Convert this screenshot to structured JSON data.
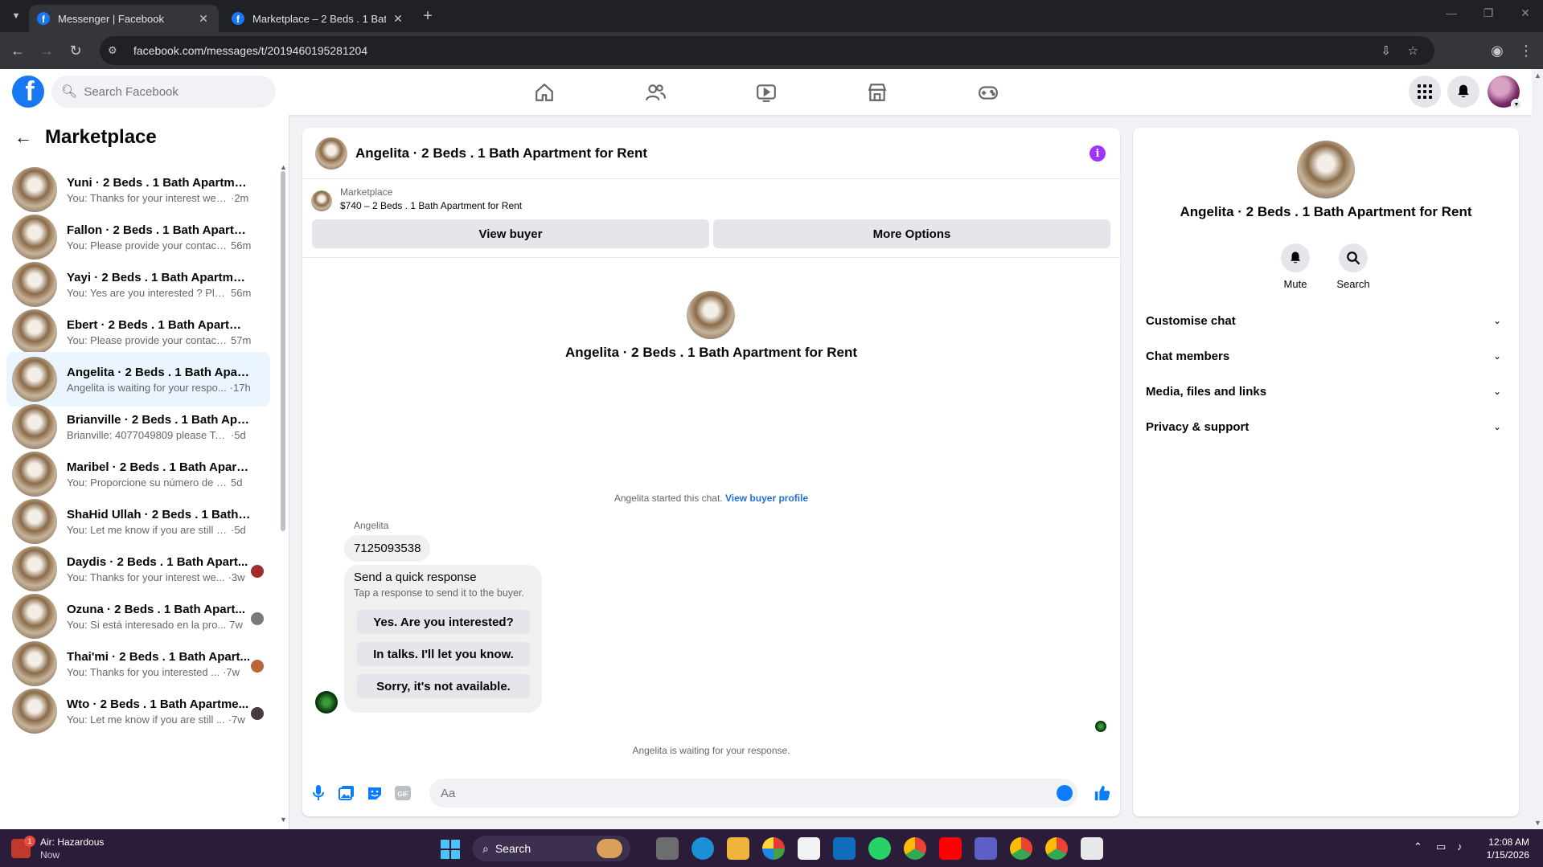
{
  "browser": {
    "tabs": [
      {
        "title": "Messenger | Facebook",
        "active": true
      },
      {
        "title": "Marketplace – 2 Beds . 1 Bath A",
        "active": false
      }
    ],
    "url": "facebook.com/messages/t/2019460195281204"
  },
  "header": {
    "search_placeholder": "Search Facebook",
    "nav_icons": [
      "home-icon",
      "friends-icon",
      "video-icon",
      "marketplace-icon",
      "gaming-icon"
    ]
  },
  "sidebar": {
    "title": "Marketplace",
    "conversations": [
      {
        "name": "Yuni · 2 Beds . 1 Bath Apartment...",
        "preview": "You: Thanks for your interest we'll ...",
        "time": "·2m",
        "active": false
      },
      {
        "name": "Fallon · 2 Beds . 1 Bath Apartme...",
        "preview": "You: Please provide your contact ...",
        "time": "56m",
        "active": false
      },
      {
        "name": "Yayi · 2 Beds . 1 Bath Apartment ...",
        "preview": "You: Yes are you interested ? Plea...",
        "time": "56m",
        "active": false
      },
      {
        "name": "Ebert · 2 Beds . 1 Bath Apartmen...",
        "preview": "You: Please provide your contact ...",
        "time": "57m",
        "active": false
      },
      {
        "name": "Angelita · 2 Beds . 1 Bath Apart...",
        "preview": "Angelita is waiting for your respo...",
        "time": "·17h",
        "active": true
      },
      {
        "name": "Brianville · 2 Beds . 1 Bath Apart...",
        "preview": "Brianville: 4077049809 please Tex ...",
        "time": "·5d",
        "active": false
      },
      {
        "name": "Maribel · 2 Beds . 1 Bath Apartm...",
        "preview": "You: Proporcione su número de co...",
        "time": "5d",
        "active": false
      },
      {
        "name": "ShaHid Ullah · 2 Beds . 1 Bath Ap...",
        "preview": "You: Let me know if you are still inn...",
        "time": "·5d",
        "active": false
      },
      {
        "name": "Daydis · 2 Beds . 1 Bath Apart...",
        "preview": "You: Thanks for your interest we...",
        "time": "·3w",
        "active": false,
        "seen": "#a52a2a"
      },
      {
        "name": "Ozuna · 2 Beds . 1 Bath Apart...",
        "preview": "You: Si está interesado en la pro...",
        "time": "7w",
        "active": false,
        "seen": "#7a7a7a"
      },
      {
        "name": "Thai'mi · 2 Beds . 1 Bath Apart...",
        "preview": "You: Thanks for you interested ...",
        "time": "·7w",
        "active": false,
        "seen": "#b8663a"
      },
      {
        "name": "Wto · 2 Beds . 1 Bath Apartme...",
        "preview": "You: Let me know if you are still ...",
        "time": "·7w",
        "active": false,
        "seen": "#4a3a3a"
      }
    ]
  },
  "chat": {
    "title": "Angelita · 2 Beds . 1 Bath Apartment for Rent",
    "marketplace_label": "Marketplace",
    "listing": "$740 – 2 Beds . 1 Bath Apartment for Rent",
    "view_buyer": "View buyer",
    "more_options": "More Options",
    "center_name": "Angelita · 2 Beds . 1 Bath Apartment for Rent",
    "started_text": "Angelita started this chat.",
    "view_profile": "View buyer profile",
    "sender": "Angelita",
    "message": "7125093538",
    "quick_title": "Send a quick response",
    "quick_sub": "Tap a response to send it to the buyer.",
    "quick_replies": [
      "Yes. Are you interested?",
      "In talks. I'll let you know.",
      "Sorry, it's not available."
    ],
    "waiting_text": "Angelita is waiting for your response.",
    "composer_placeholder": "Aa"
  },
  "details": {
    "name": "Angelita · 2 Beds . 1 Bath Apartment for Rent",
    "mute": "Mute",
    "search": "Search",
    "sections": [
      "Customise chat",
      "Chat members",
      "Media, files and links",
      "Privacy & support"
    ]
  },
  "taskbar": {
    "weather_title": "Air: Hazardous",
    "weather_sub": "Now",
    "weather_badge": "1",
    "search_label": "Search",
    "time": "12:08 AM",
    "date": "1/15/2026"
  },
  "colors": {
    "fb_blue": "#1877f2",
    "active_conv": "#ebf5ff",
    "info_purple": "#a033ff",
    "link_blue": "#216fdb"
  }
}
